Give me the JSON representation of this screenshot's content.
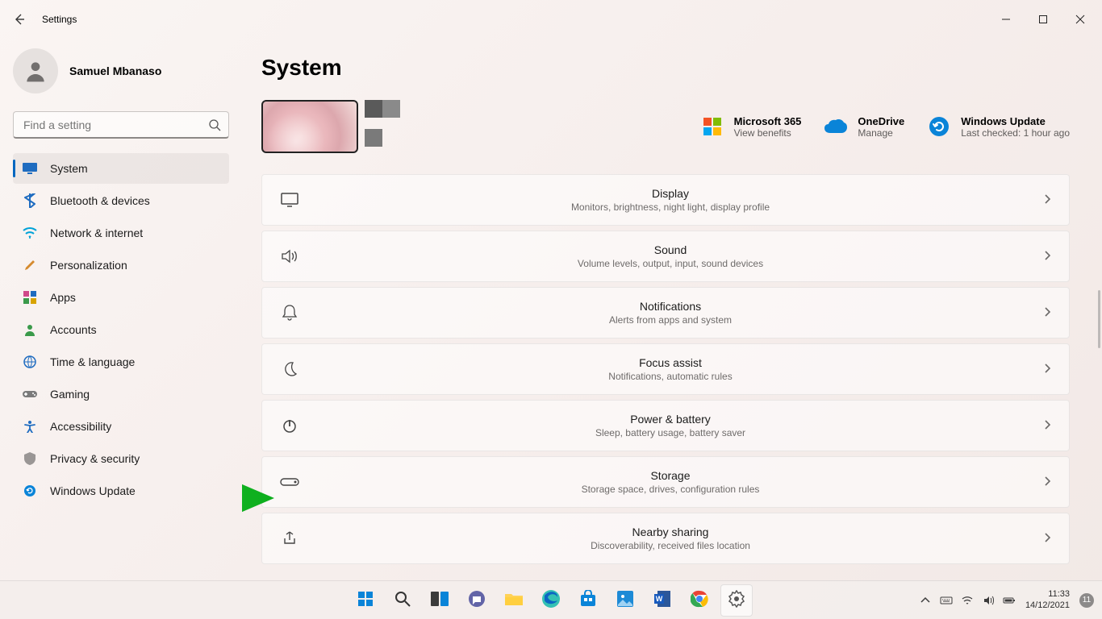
{
  "window": {
    "title": "Settings"
  },
  "user": {
    "name": "Samuel Mbanaso"
  },
  "search": {
    "placeholder": "Find a setting"
  },
  "nav": {
    "items": [
      {
        "label": "System",
        "icon": "monitor-icon",
        "active": true
      },
      {
        "label": "Bluetooth & devices",
        "icon": "bluetooth-icon",
        "active": false
      },
      {
        "label": "Network & internet",
        "icon": "wifi-icon",
        "active": false
      },
      {
        "label": "Personalization",
        "icon": "brush-icon",
        "active": false
      },
      {
        "label": "Apps",
        "icon": "apps-icon",
        "active": false
      },
      {
        "label": "Accounts",
        "icon": "person-icon",
        "active": false
      },
      {
        "label": "Time & language",
        "icon": "globe-icon",
        "active": false
      },
      {
        "label": "Gaming",
        "icon": "gamepad-icon",
        "active": false
      },
      {
        "label": "Accessibility",
        "icon": "accessibility-icon",
        "active": false
      },
      {
        "label": "Privacy & security",
        "icon": "shield-icon",
        "active": false
      },
      {
        "label": "Windows Update",
        "icon": "update-icon",
        "active": false
      }
    ]
  },
  "page": {
    "title": "System"
  },
  "status": [
    {
      "title": "Microsoft 365",
      "sub": "View benefits",
      "icon": "microsoft-icon"
    },
    {
      "title": "OneDrive",
      "sub": "Manage",
      "icon": "onedrive-icon"
    },
    {
      "title": "Windows Update",
      "sub": "Last checked: 1 hour ago",
      "icon": "update-icon"
    }
  ],
  "cards": [
    {
      "title": "Display",
      "sub": "Monitors, brightness, night light, display profile",
      "icon": "display-icon"
    },
    {
      "title": "Sound",
      "sub": "Volume levels, output, input, sound devices",
      "icon": "sound-icon"
    },
    {
      "title": "Notifications",
      "sub": "Alerts from apps and system",
      "icon": "bell-icon"
    },
    {
      "title": "Focus assist",
      "sub": "Notifications, automatic rules",
      "icon": "moon-icon"
    },
    {
      "title": "Power & battery",
      "sub": "Sleep, battery usage, battery saver",
      "icon": "power-icon"
    },
    {
      "title": "Storage",
      "sub": "Storage space, drives, configuration rules",
      "icon": "storage-icon"
    },
    {
      "title": "Nearby sharing",
      "sub": "Discoverability, received files location",
      "icon": "share-icon"
    }
  ],
  "taskbar": {
    "apps": [
      {
        "name": "start-icon"
      },
      {
        "name": "search-icon"
      },
      {
        "name": "taskview-icon"
      },
      {
        "name": "chat-icon"
      },
      {
        "name": "explorer-icon"
      },
      {
        "name": "edge-icon"
      },
      {
        "name": "store-icon"
      },
      {
        "name": "photos-icon"
      },
      {
        "name": "word-icon"
      },
      {
        "name": "chrome-icon"
      },
      {
        "name": "settings-icon"
      }
    ],
    "clock": {
      "time": "11:33",
      "date": "14/12/2021"
    },
    "notif_count": "11"
  }
}
